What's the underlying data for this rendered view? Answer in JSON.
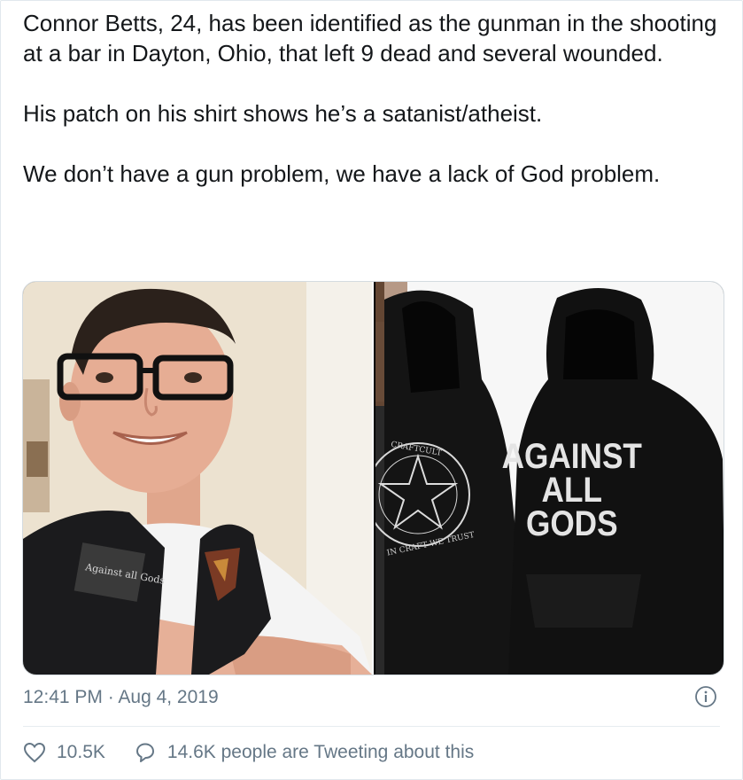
{
  "tweet": {
    "paragraphs": [
      "Connor Betts, 24, has been identified as the gunman in the shooting at a bar in Dayton, Ohio, that left 9 dead and several wounded.",
      "His patch on his shirt shows he’s a satanist/atheist.",
      "We don’t have a gun problem, we have a lack of God problem."
    ],
    "timestamp": "12:41 PM · Aug 4, 2019"
  },
  "media": {
    "left_photo": {
      "patch_text": "Against all Gods"
    },
    "right_photo": {
      "front_logo_text_top": "CRAFTCULT",
      "front_logo_text_bottom": "IN CRAFT WE TRUST",
      "back_print": [
        "AGAINST",
        "ALL",
        "GODS"
      ]
    }
  },
  "actions": {
    "likes": "10.5K",
    "tweeting": "14.6K people are Tweeting about this"
  },
  "colors": {
    "text": "#14171a",
    "secondary": "#657786",
    "border": "#e1e8ed"
  },
  "icons": [
    "heart-icon",
    "comment-icon",
    "info-icon"
  ]
}
